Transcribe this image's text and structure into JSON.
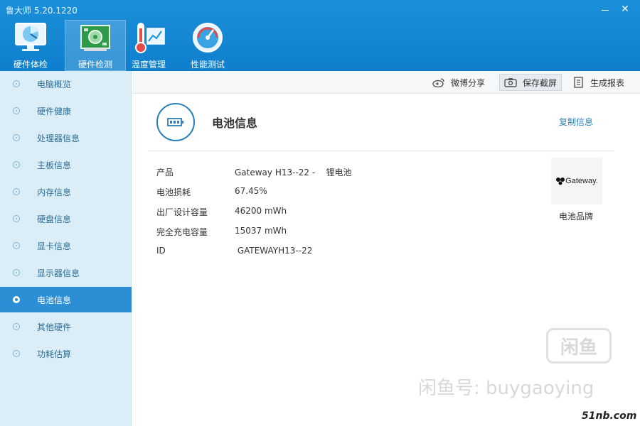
{
  "window": {
    "title": "鲁大师 5.20.1220",
    "minimize_icon": "minimize-icon",
    "close_icon": "close-icon",
    "close_glyph": "✕"
  },
  "nav": {
    "tabs": [
      {
        "label": "硬件体检",
        "icon": "monitor-scan-icon"
      },
      {
        "label": "硬件检测",
        "icon": "circuit-board-icon",
        "active": true
      },
      {
        "label": "温度管理",
        "icon": "thermometer-icon"
      },
      {
        "label": "性能测试",
        "icon": "speedometer-icon"
      }
    ]
  },
  "sidebar": {
    "items": [
      {
        "label": "电脑概览"
      },
      {
        "label": "硬件健康"
      },
      {
        "label": "处理器信息"
      },
      {
        "label": "主板信息"
      },
      {
        "label": "内存信息"
      },
      {
        "label": "硬盘信息"
      },
      {
        "label": "显卡信息"
      },
      {
        "label": "显示器信息"
      },
      {
        "label": "电池信息",
        "active": true
      },
      {
        "label": "其他硬件"
      },
      {
        "label": "功耗估算"
      }
    ]
  },
  "toolbar": {
    "weibo_share": "微博分享",
    "save_screenshot": "保存截屏",
    "generate_report": "生成报表"
  },
  "battery": {
    "section_title": "电池信息",
    "copy_info": "复制信息",
    "rows": [
      {
        "label": "产品",
        "value": "Gateway H13--22 -    锂电池"
      },
      {
        "label": "电池损耗",
        "value": "67.45%"
      },
      {
        "label": "出厂设计容量",
        "value": "46200 mWh"
      },
      {
        "label": "完全充电容量",
        "value": "15037 mWh"
      },
      {
        "label": "ID",
        "value": " GATEWAYH13--22"
      }
    ],
    "brand_logo_text": "Gateway.",
    "brand_caption": "电池品牌"
  },
  "watermark": {
    "box_text": "闲鱼",
    "text": "闲鱼号:  buygaoying",
    "site": "51nb.com"
  },
  "colors": {
    "title_bar": "#1b8fd9",
    "sidebar_bg": "#dbeef8",
    "active_item": "#2c8fd6",
    "link": "#2b7fb8"
  }
}
